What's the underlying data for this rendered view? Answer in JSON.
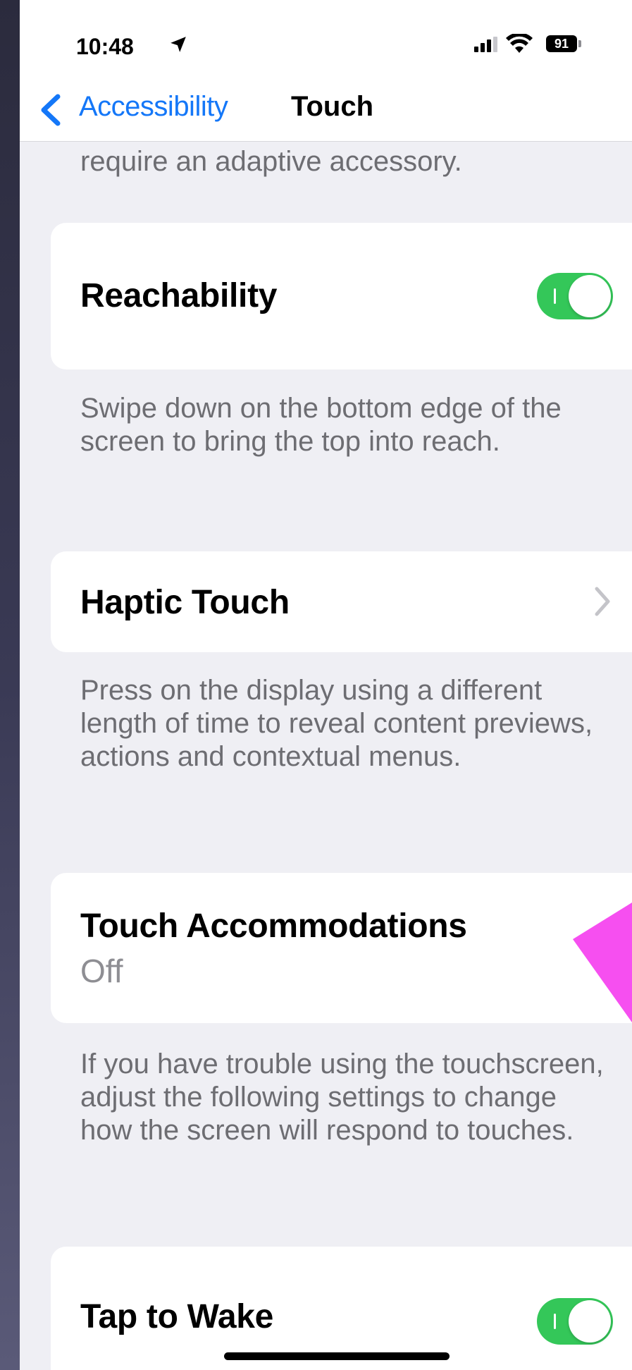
{
  "status_bar": {
    "time": "10:48",
    "battery": "91"
  },
  "nav": {
    "back_label": "Accessibility",
    "title": "Touch"
  },
  "top_note": "require an adaptive accessory.",
  "reachability": {
    "title": "Reachability",
    "toggle_on": true,
    "footer": "Swipe down on the bottom edge of the screen to bring the top into reach."
  },
  "haptic_touch": {
    "title": "Haptic Touch",
    "footer": "Press on the display using a different length of time to reveal content previews, actions and contextual menus."
  },
  "touch_accommodations": {
    "title": "Touch Accommodations",
    "value": "Off",
    "footer": "If you have trouble using the touchscreen, adjust the following settings to change how the screen will respond to touches."
  },
  "tap_to_wake": {
    "title": "Tap to Wake",
    "toggle_on": true
  },
  "colors": {
    "accent": "#1477f8",
    "toggle_on": "#34c759",
    "annotation_arrow": "#f64ff0"
  }
}
